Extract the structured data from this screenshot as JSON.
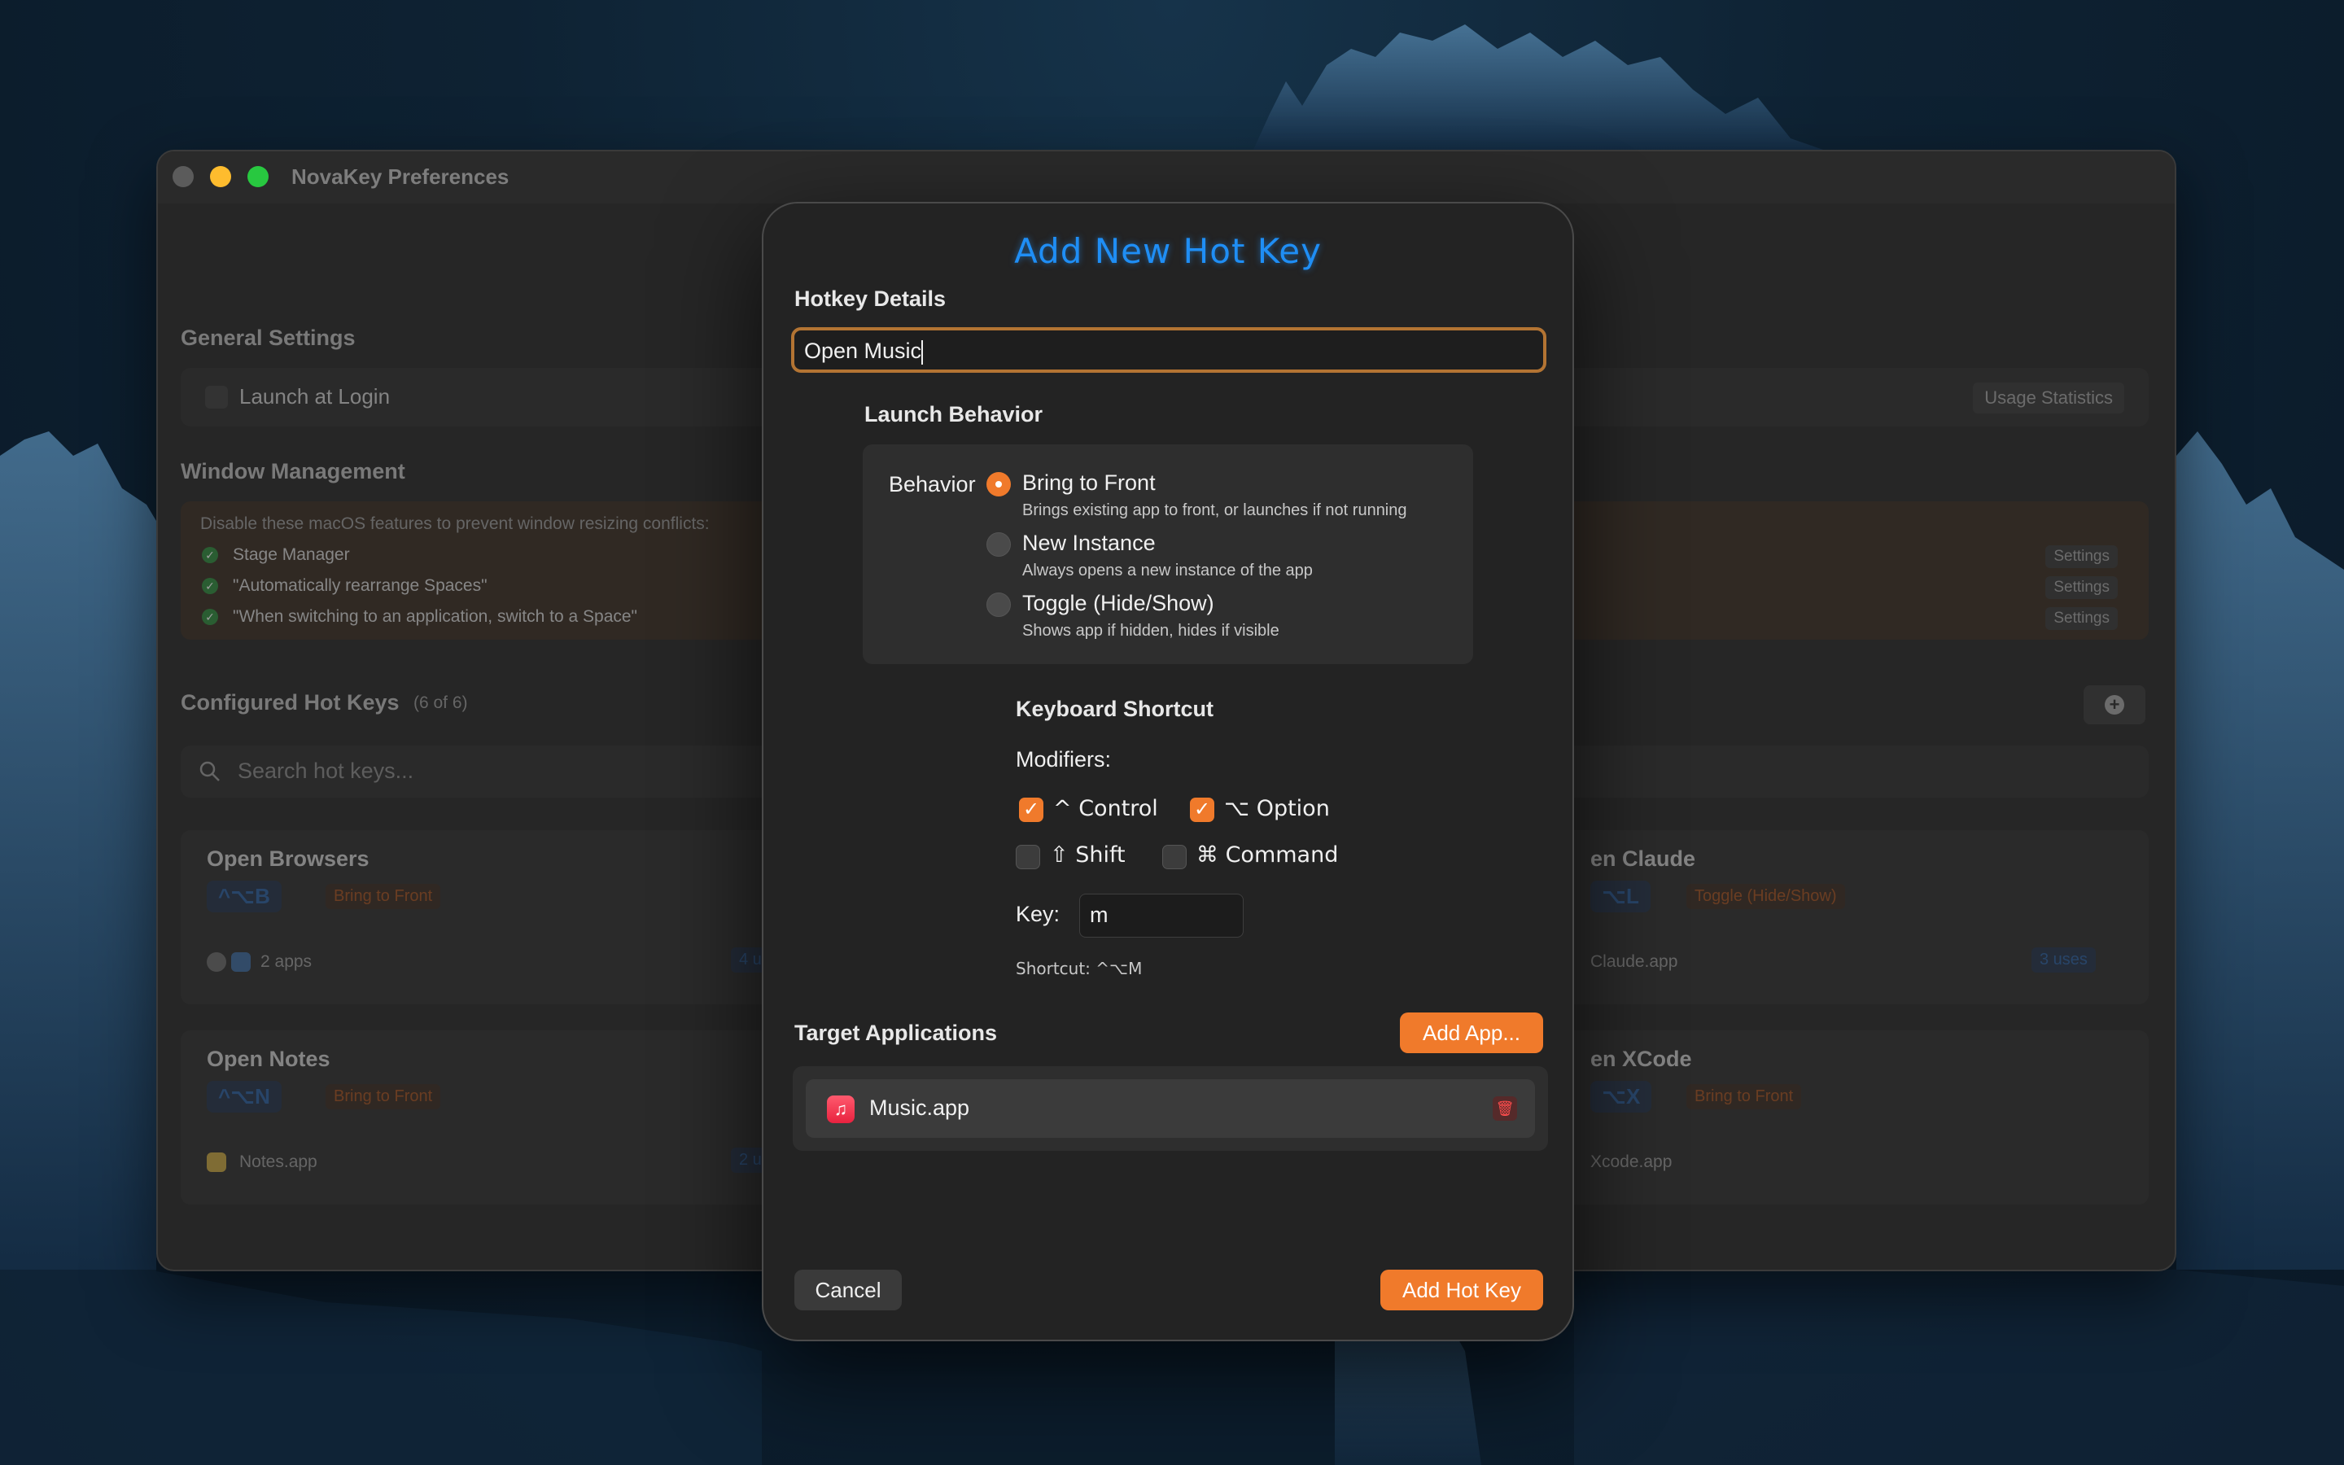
{
  "window": {
    "title": "NovaKey Preferences",
    "general_settings_heading": "General Settings",
    "launch_at_login_label": "Launch at Login",
    "usage_statistics_button": "Usage Statistics",
    "window_management_heading": "Window Management",
    "window_management_note": "Disable these macOS features to prevent window resizing conflicts:",
    "wm_items": [
      {
        "label": "Stage Manager",
        "button": "Settings"
      },
      {
        "label": "\"Automatically rearrange Spaces\"",
        "button": "Settings"
      },
      {
        "label": "\"When switching to an application, switch to a Space\"",
        "button": "Settings"
      }
    ],
    "configured_heading": "Configured Hot Keys",
    "configured_count": "(6 of 6)",
    "search_placeholder": "Search hot keys...",
    "hotkey_cards": [
      {
        "title": "Open Browsers",
        "shortcut": "^⌥B",
        "behavior": "Bring to Front",
        "apps": "2 apps",
        "uses": "4 u"
      },
      {
        "title": "en Claude",
        "shortcut": "⌥L",
        "behavior": "Toggle (Hide/Show)",
        "apps": "Claude.app",
        "uses": "3 uses"
      },
      {
        "title": "Open Notes",
        "shortcut": "^⌥N",
        "behavior": "Bring to Front",
        "apps": "Notes.app",
        "uses": "2 u"
      },
      {
        "title": "en XCode",
        "shortcut": "⌥X",
        "behavior": "Bring to Front",
        "apps": "Xcode.app",
        "uses": ""
      }
    ]
  },
  "sheet": {
    "title": "Add New Hot Key",
    "hotkey_details_label": "Hotkey Details",
    "name_value": "Open Music",
    "launch_behavior_heading": "Launch Behavior",
    "behavior_label": "Behavior",
    "behavior_options": [
      {
        "title": "Bring to Front",
        "desc": "Brings existing app to front, or launches if not running",
        "selected": true
      },
      {
        "title": "New Instance",
        "desc": "Always opens a new instance of the app",
        "selected": false
      },
      {
        "title": "Toggle (Hide/Show)",
        "desc": "Shows app if hidden, hides if visible",
        "selected": false
      }
    ],
    "keyboard_shortcut_heading": "Keyboard Shortcut",
    "modifiers_label": "Modifiers:",
    "modifiers": [
      {
        "label": "^ Control",
        "checked": true
      },
      {
        "label": "⌥ Option",
        "checked": true
      },
      {
        "label": "⇧ Shift",
        "checked": false
      },
      {
        "label": "⌘ Command",
        "checked": false
      }
    ],
    "key_label": "Key:",
    "key_value": "m",
    "shortcut_preview": "Shortcut: ^⌥M",
    "target_apps_heading": "Target Applications",
    "add_app_button": "Add App...",
    "apps": [
      {
        "name": "Music.app",
        "icon": "music-icon"
      }
    ],
    "cancel_button": "Cancel",
    "add_hotkey_button": "Add Hot Key"
  },
  "colors": {
    "accent": "#f07a2b",
    "title_blue": "#1f8ef5",
    "input_focus": "#b37433"
  }
}
